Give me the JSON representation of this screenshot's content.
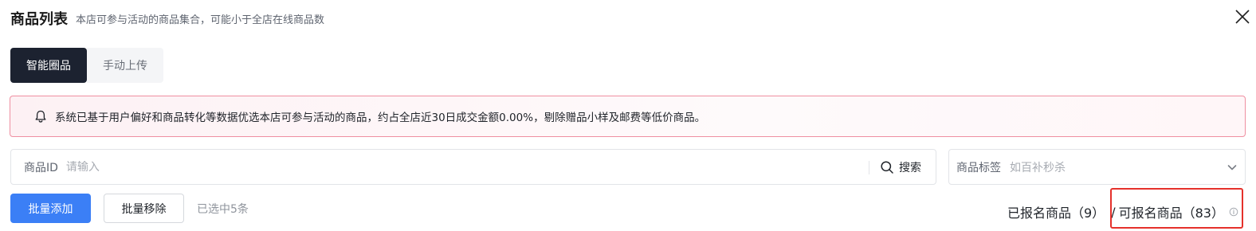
{
  "header": {
    "title": "商品列表",
    "subtitle": "本店可参与活动的商品集合，可能小于全店在线商品数",
    "close_icon": "close-icon"
  },
  "tabs": [
    {
      "label": "智能圈品",
      "active": true
    },
    {
      "label": "手动上传",
      "active": false
    }
  ],
  "notice": {
    "icon": "bell-icon",
    "text": "系统已基于用户偏好和商品转化等数据优选本店可参与活动的商品，约占全店近30日成交金额0.00%，剔除赠品小样及邮费等低价商品。"
  },
  "filters": {
    "product_id": {
      "label": "商品ID",
      "placeholder": "请输入",
      "value": ""
    },
    "search_button": {
      "label": "搜索",
      "icon": "search-icon"
    },
    "product_tag": {
      "label": "商品标签",
      "placeholder": "如百补秒杀",
      "icon": "chevron-down-icon"
    }
  },
  "actions": {
    "batch_add": "批量添加",
    "batch_remove": "批量移除",
    "selected_count": "已选中5条"
  },
  "stats": {
    "registered": "已报名商品（9）",
    "separator": "/",
    "available": "可报名商品（83）",
    "info_icon": "info-icon"
  },
  "colors": {
    "primary": "#3b7ff6",
    "active_tab": "#1c2230",
    "notice_border": "#ef8fa1",
    "highlight": "#e5312b"
  }
}
